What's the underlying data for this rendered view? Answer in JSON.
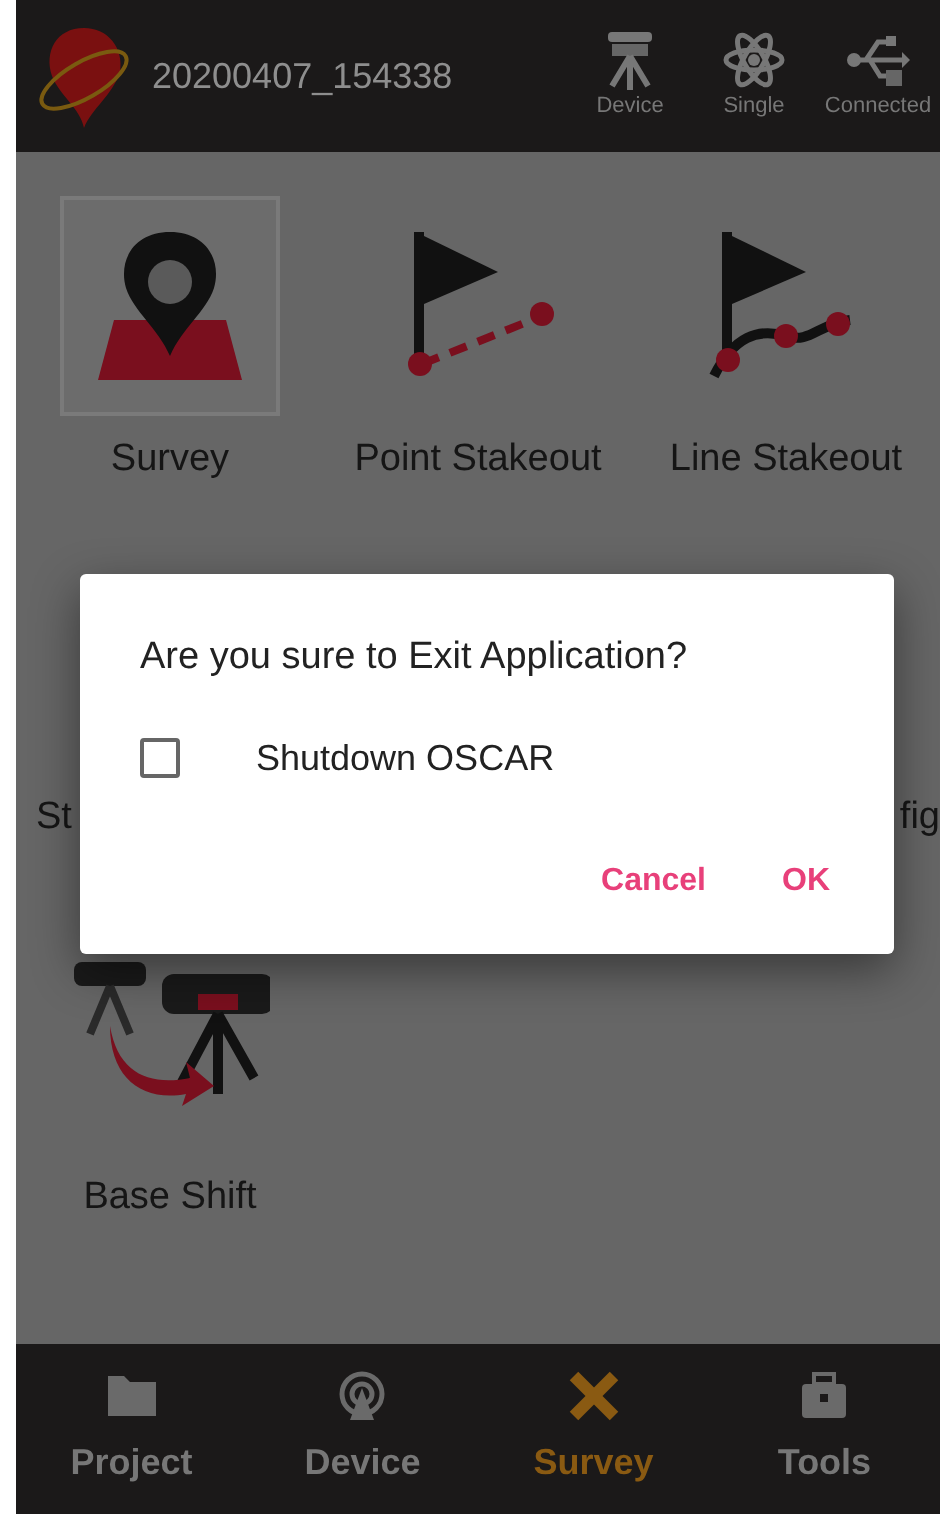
{
  "header": {
    "title": "20200407_154338",
    "status": [
      {
        "label": "Device",
        "kind": "device"
      },
      {
        "label": "Single",
        "kind": "solution"
      },
      {
        "label": "Connected",
        "kind": "usb"
      }
    ]
  },
  "apps": [
    [
      {
        "label": "Survey",
        "kind": "survey",
        "selected": true
      },
      {
        "label": "Point Stakeout",
        "kind": "point",
        "selected": false
      },
      {
        "label": "Line Stakeout",
        "kind": "line",
        "selected": false
      }
    ],
    [
      {
        "label": "St",
        "kind": "covered"
      },
      {
        "label": "fig",
        "kind": "covered"
      }
    ],
    [
      {
        "label": "Base Shift",
        "kind": "base",
        "selected": false
      }
    ]
  ],
  "dialog": {
    "title": "Are you sure to Exit Application?",
    "checkbox": {
      "label": "Shutdown OSCAR",
      "checked": false
    },
    "buttons": [
      "Cancel",
      "OK"
    ]
  },
  "nav": [
    {
      "label": "Project",
      "kind": "folder",
      "selected": false
    },
    {
      "label": "Device",
      "kind": "antenna",
      "selected": false
    },
    {
      "label": "Survey",
      "kind": "tools",
      "selected": true
    },
    {
      "label": "Tools",
      "kind": "toolbox",
      "selected": false
    }
  ]
}
